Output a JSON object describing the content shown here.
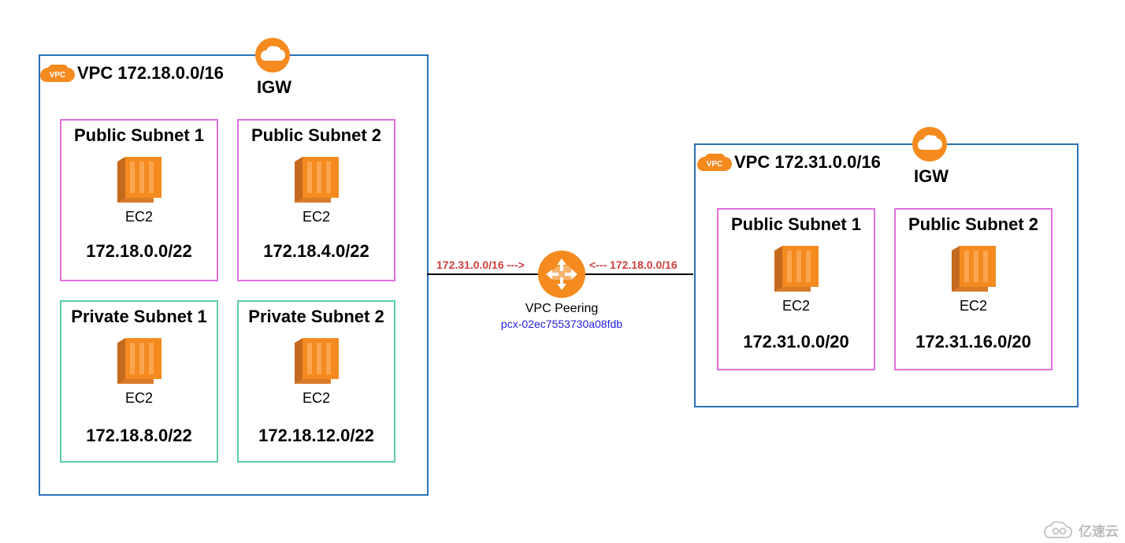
{
  "vpc_a": {
    "title": "VPC 172.18.0.0/16",
    "igw": "IGW",
    "subnets": {
      "pub1": {
        "title": "Public Subnet 1",
        "ec2": "EC2",
        "cidr": "172.18.0.0/22"
      },
      "pub2": {
        "title": "Public Subnet 2",
        "ec2": "EC2",
        "cidr": "172.18.4.0/22"
      },
      "priv1": {
        "title": "Private Subnet 1",
        "ec2": "EC2",
        "cidr": "172.18.8.0/22"
      },
      "priv2": {
        "title": "Private Subnet 2",
        "ec2": "EC2",
        "cidr": "172.18.12.0/22"
      }
    }
  },
  "vpc_b": {
    "title": "VPC 172.31.0.0/16",
    "igw": "IGW",
    "subnets": {
      "pub1": {
        "title": "Public Subnet 1",
        "ec2": "EC2",
        "cidr": "172.31.0.0/20"
      },
      "pub2": {
        "title": "Public Subnet 2",
        "ec2": "EC2",
        "cidr": "172.31.16.0/20"
      }
    }
  },
  "peering": {
    "route_left": "172.31.0.0/16 --->",
    "route_right": "<--- 172.18.0.0/16",
    "label": "VPC Peering",
    "id": "pcx-02ec7553730a08fdb"
  },
  "watermark": "亿速云"
}
